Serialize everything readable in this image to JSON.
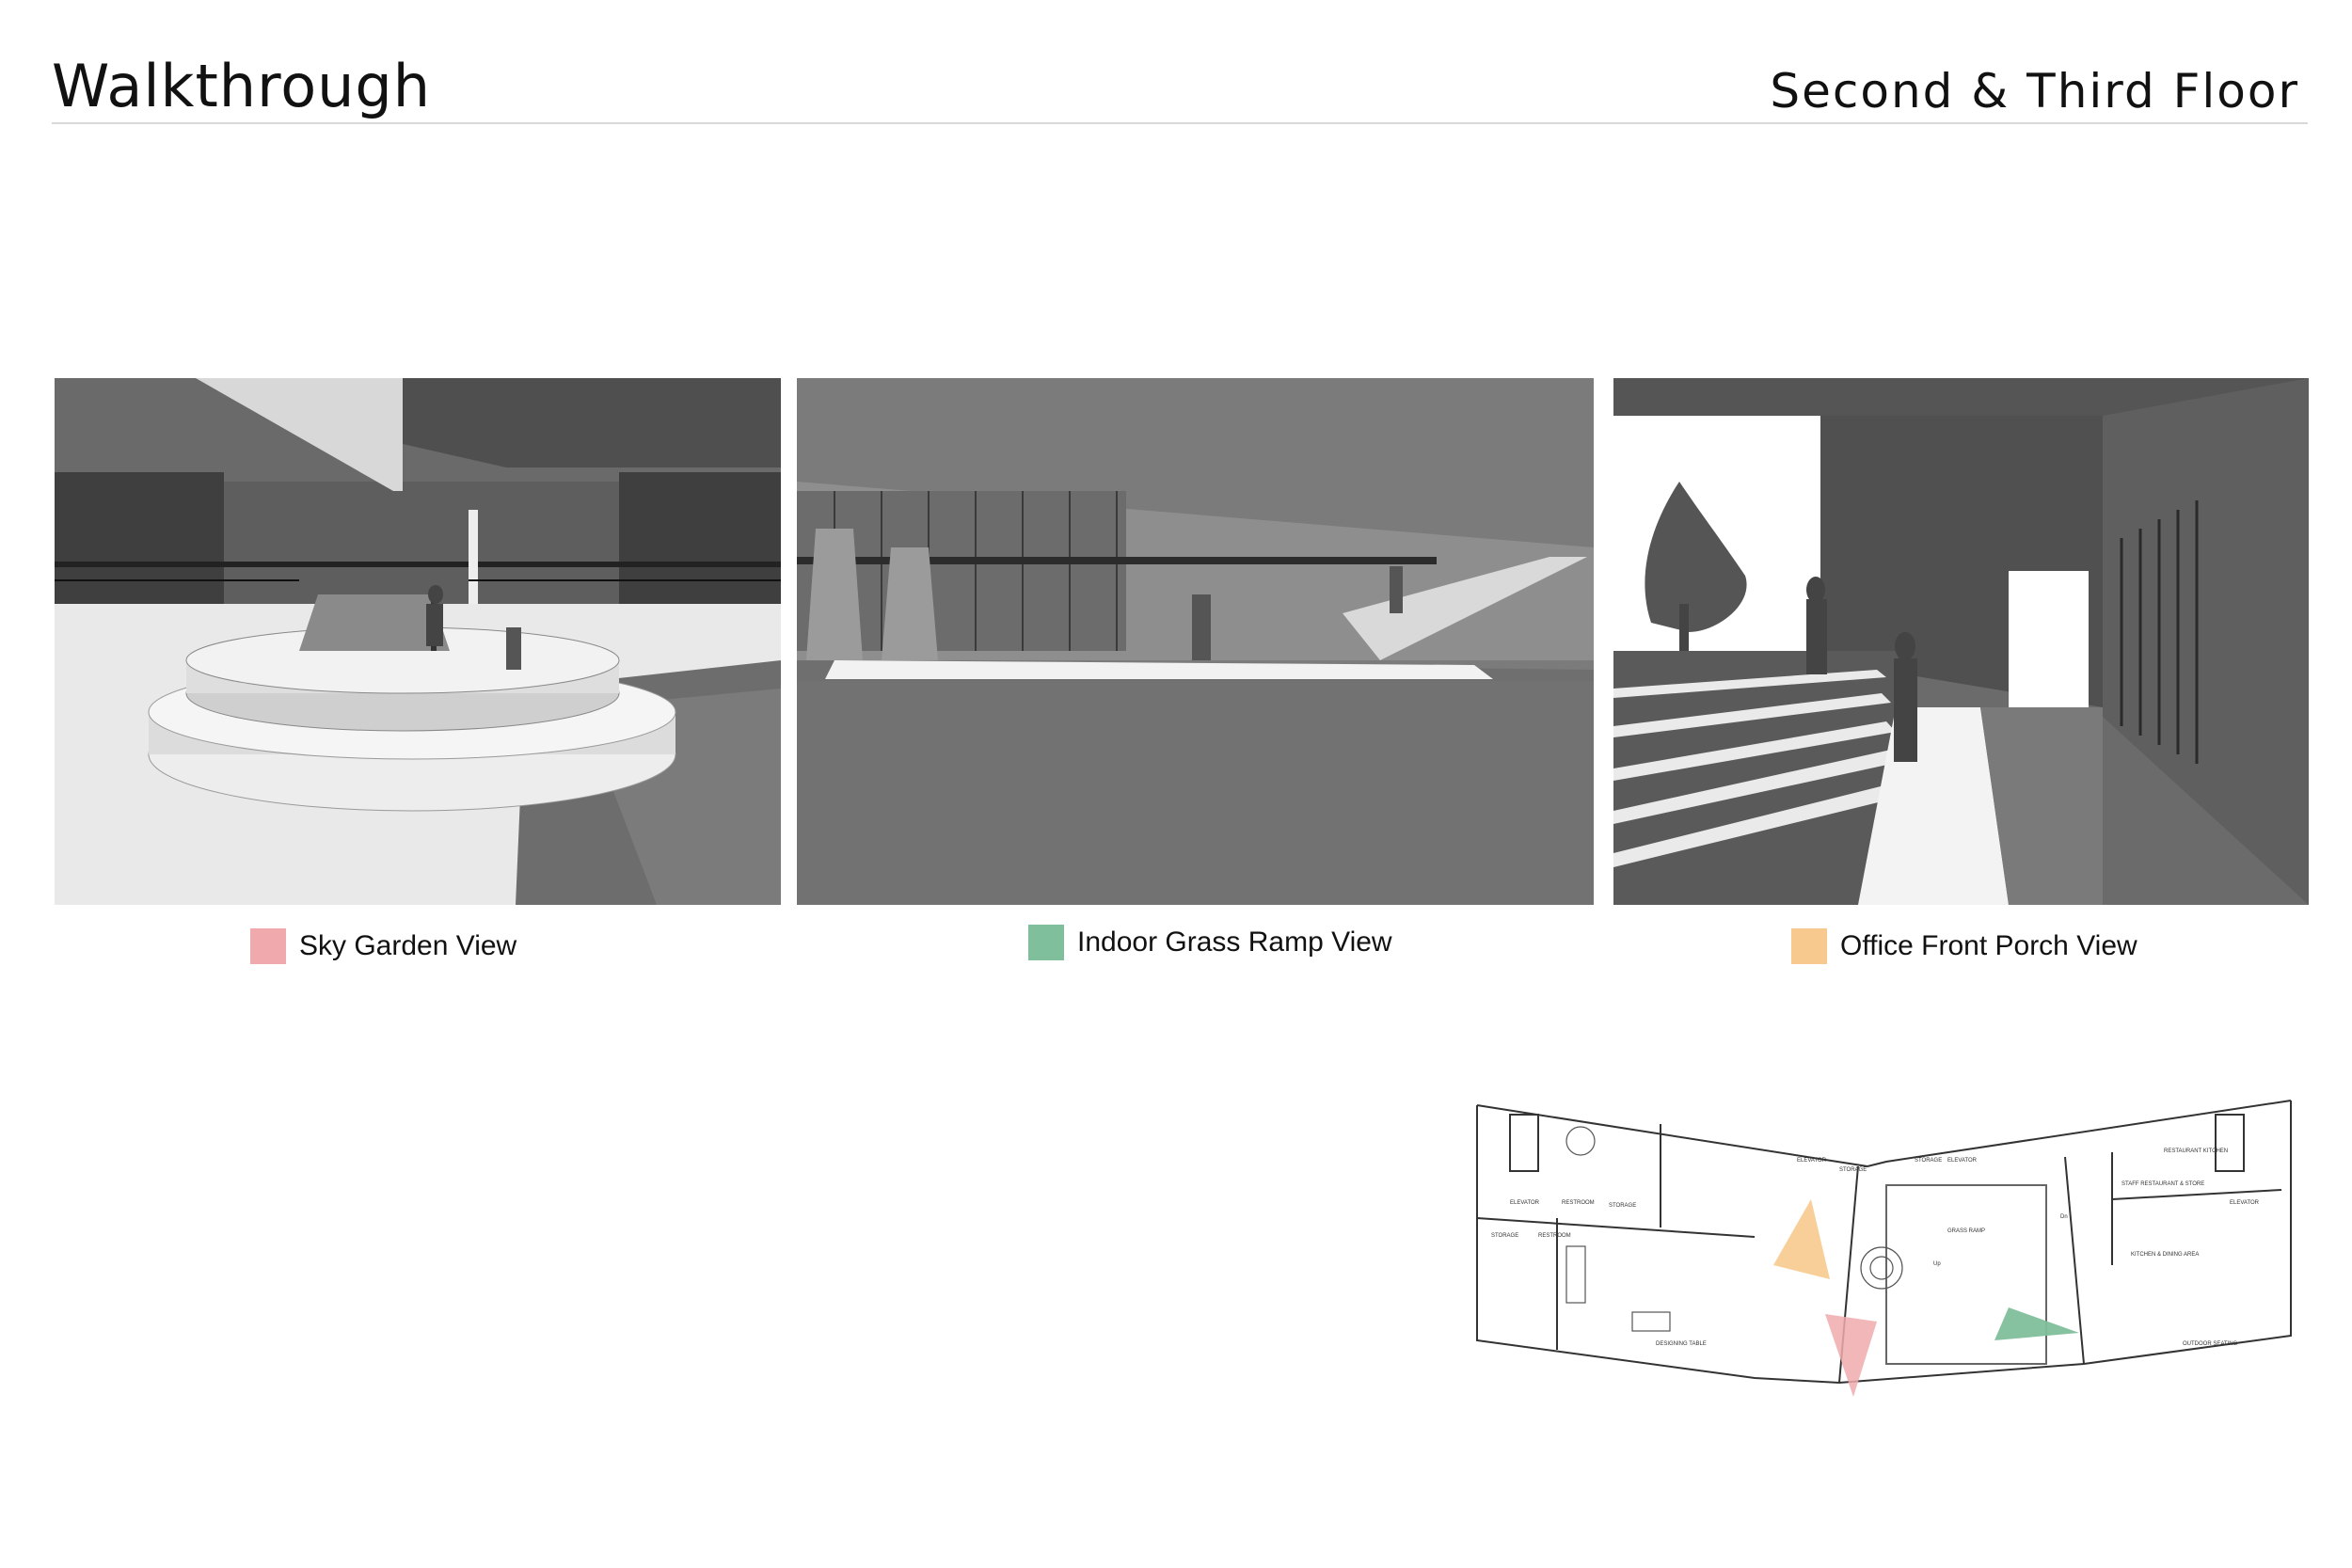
{
  "header": {
    "title": "Walkthrough",
    "subtitle": "Second & Third Floor"
  },
  "views": [
    {
      "label": "Sky Garden View",
      "color": "#f0aaad"
    },
    {
      "label": "Indoor Grass Ramp View",
      "color": "#7fbf9b"
    },
    {
      "label": "Office Front Porch View",
      "color": "#f7c98e"
    }
  ],
  "plan": {
    "labels": {
      "elevator_1": "ELEVATOR",
      "elevator_2": "ELEVATOR",
      "elevator_3": "ELEVATOR",
      "elevator_4": "ELEVATOR",
      "storage_1": "STORAGE",
      "storage_2": "STORAGE",
      "storage_3": "STORAGE",
      "storage_4": "STORAGE",
      "restroom_1": "RESTROOM",
      "restroom_2": "RESTROOM",
      "grass_ramp": "GRASS RAMP",
      "restaurant_kitchen": "RESTAURANT KITCHEN",
      "staff_restaurant": "STAFF RESTAURANT & STORE",
      "kitchen_dining": "KITCHEN & DINING AREA",
      "outdoor_seating": "OUTDOOR SEATING",
      "designing_table": "DESIGNING TABLE",
      "up": "Up",
      "dn": "Dn"
    }
  }
}
